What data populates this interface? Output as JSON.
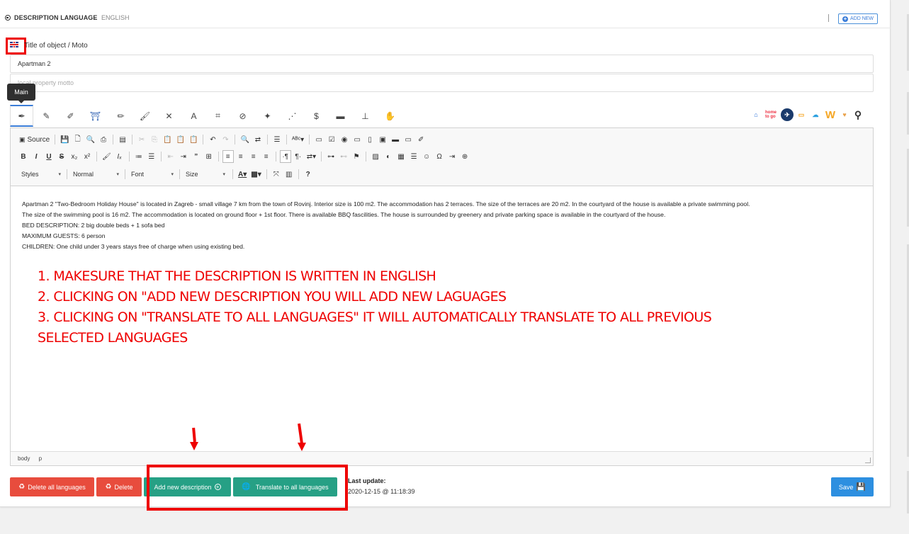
{
  "header": {
    "title": "DESCRIPTION LANGUAGE",
    "separator": "-",
    "language": "ENGLISH",
    "add_new_label": "ADD NEW"
  },
  "title_field": {
    "label": "Title of object / Moto",
    "value": "Apartman 2",
    "motto_placeholder": "local property motto"
  },
  "tooltip": "Main",
  "tabs": [
    "main-pen",
    "pencil",
    "pen-nib",
    "arch",
    "pencil-2",
    "brush",
    "tools",
    "text-style",
    "crop",
    "no-pen",
    "magic-wand",
    "nodes",
    "dollar",
    "bed",
    "desk",
    "hand"
  ],
  "channels": [
    "home-icon",
    "hometogo",
    "plane-circle",
    "youtube",
    "cloud",
    "w",
    "heart",
    "map-pin"
  ],
  "channel_hometogo_text": "home to go",
  "toolbar": {
    "source_label": "Source",
    "styles_label": "Styles",
    "format_label": "Normal",
    "font_label": "Font",
    "size_label": "Size"
  },
  "content": {
    "line1": "Apartman 2  \"Two-Bedroom Holiday House\" is located in Zagreb  - small village 7 km from the town of Rovinj. Interior size is 100 m2. The accommodation has 2 terraces. The size of the terraces are 20 m2. In the courtyard of the house is available a private swimming pool.",
    "line2": "The size of the swimming pool is 16 m2. The accommodation is located on ground floor + 1st floor. There is available BBQ fascilities. The house is surrounded by greenery and private parking space is available in the courtyard of the house.",
    "line3": "BED DESCRIPTION: 2  big double beds + 1 sofa bed",
    "line4": "MAXIMUM GUESTS: 6 person",
    "line5": "CHILDREN: One child under 3 years stays free of charge when using existing bed."
  },
  "instructions": {
    "line1": "1. MAKESURE THAT THE DESCRIPTION IS WRITTEN IN ENGLISH",
    "line2": "2. CLICKING ON \"ADD NEW DESCRIPTION YOU WILL ADD NEW LAGUAGES",
    "line3": "3. CLICKING ON \"TRANSLATE TO ALL LANGUAGES\" IT WILL AUTOMATICALLY TRANSLATE TO ALL PREVIOUS",
    "line4": "SELECTED LANGUAGES"
  },
  "statusbar": {
    "el1": "body",
    "el2": "p"
  },
  "buttons": {
    "delete_all": "Delete all languages",
    "delete": "Delete",
    "add_new_description": "Add new description",
    "translate_all": "Translate to all languages",
    "save": "Save"
  },
  "last_update": {
    "label": "Last update:",
    "value": "2020-12-15 @ 11:18:39"
  },
  "colors": {
    "red_button": "#e84c3d",
    "teal_button": "#26a085",
    "blue_button": "#2d8fe0",
    "annotation_red": "#ee0000"
  }
}
